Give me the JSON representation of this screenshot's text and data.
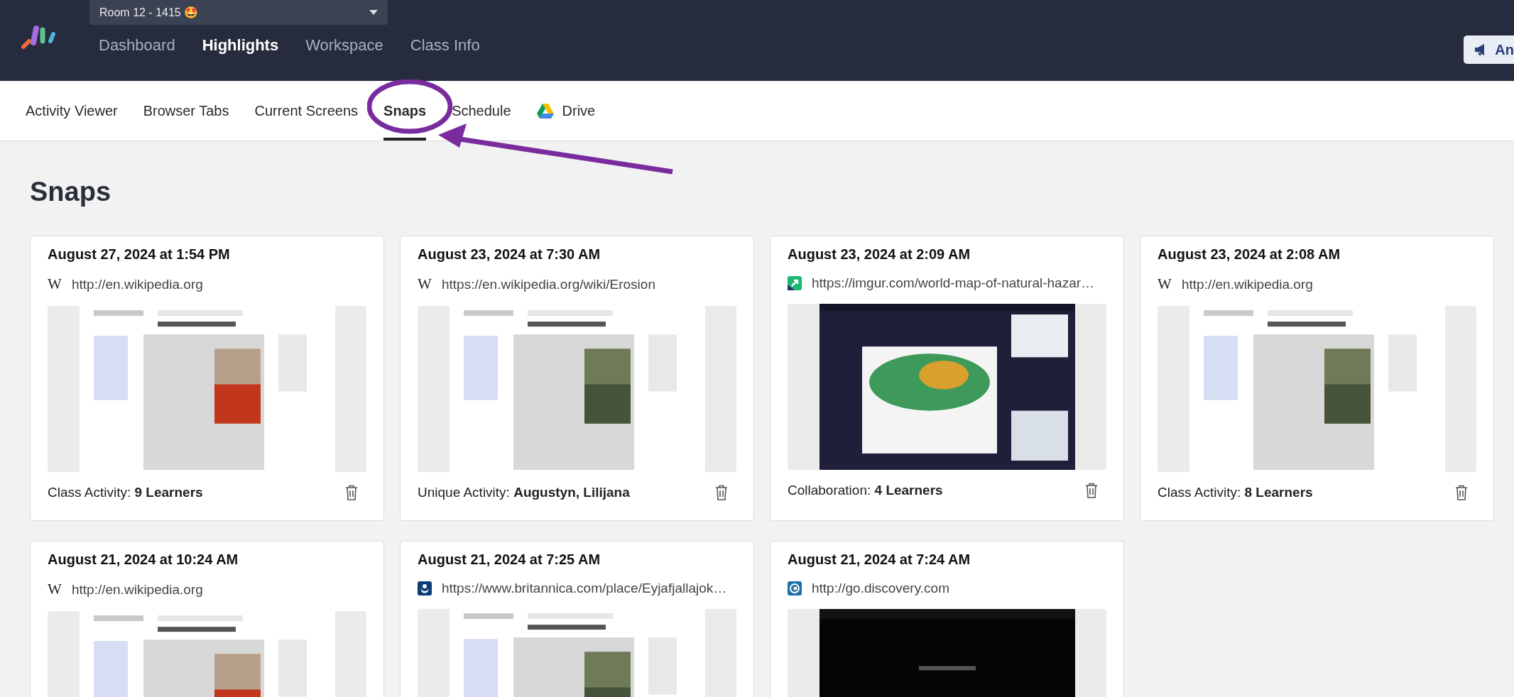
{
  "room": {
    "label": "Room 12 - 1415 🤩"
  },
  "nav": [
    {
      "label": "Dashboard",
      "selected": false
    },
    {
      "label": "Highlights",
      "selected": true
    },
    {
      "label": "Workspace",
      "selected": false
    },
    {
      "label": "Class Info",
      "selected": false
    }
  ],
  "header_button": {
    "label": "An"
  },
  "subnav": [
    {
      "label": "Activity Viewer",
      "selected": false,
      "kind": "text"
    },
    {
      "label": "Browser Tabs",
      "selected": false,
      "kind": "text"
    },
    {
      "label": "Current Screens",
      "selected": false,
      "kind": "text"
    },
    {
      "label": "Snaps",
      "selected": true,
      "kind": "text"
    },
    {
      "label": "Schedule",
      "selected": false,
      "kind": "text"
    },
    {
      "label": "Drive",
      "selected": false,
      "kind": "drive"
    }
  ],
  "heading": "Snaps",
  "snaps": [
    {
      "date": "August 27, 2024 at 1:54 PM",
      "favicon": {
        "kind": "glyph",
        "text": "W"
      },
      "url": "http://en.wikipedia.org",
      "activity": "Class Activity: **9 Learners**"
    },
    {
      "date": "August 23, 2024 at 7:30 AM",
      "favicon": {
        "kind": "glyph",
        "text": "W"
      },
      "url": "https://en.wikipedia.org/wiki/Erosion",
      "activity": "Unique Activity: **Augustyn, Lilijana**"
    },
    {
      "date": "August 23, 2024 at 2:09 AM",
      "favicon": {
        "kind": "arrow"
      },
      "url": "https://imgur.com/world-map-of-natural-hazar…",
      "activity": "Collaboration: **4 Learners**"
    },
    {
      "date": "August 23, 2024 at 2:08 AM",
      "favicon": {
        "kind": "glyph",
        "text": "W"
      },
      "url": "http://en.wikipedia.org",
      "activity": "Class Activity: **8 Learners**"
    },
    {
      "date": "August 21, 2024 at 10:24 AM",
      "favicon": {
        "kind": "glyph",
        "text": "W"
      },
      "url": "http://en.wikipedia.org"
    },
    {
      "date": "August 21, 2024 at 7:25 AM",
      "favicon": {
        "kind": "emblem"
      },
      "url": "https://www.britannica.com/place/Eyjafjallajok…"
    },
    {
      "date": "August 21, 2024 at 7:24 AM",
      "favicon": {
        "kind": "spiral"
      },
      "url": "http://go.discovery.com"
    }
  ]
}
